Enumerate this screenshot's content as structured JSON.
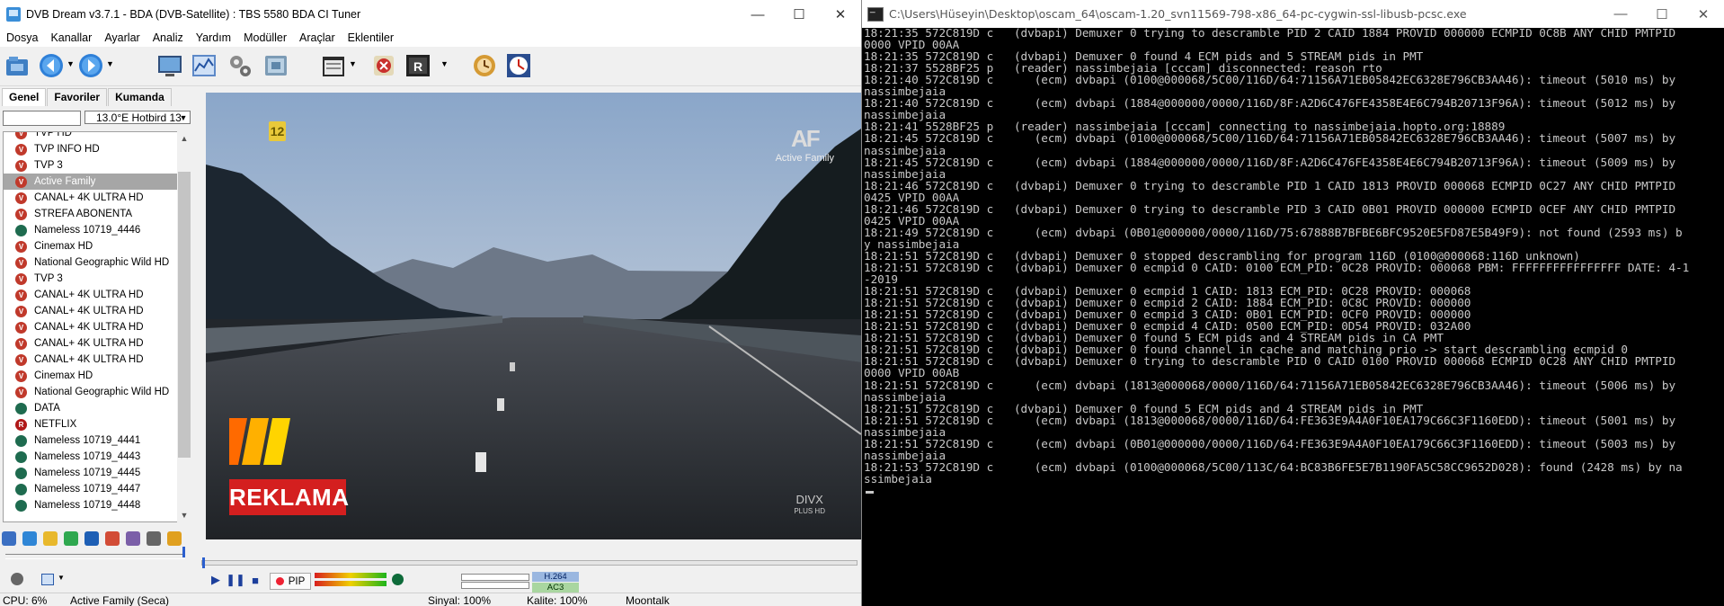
{
  "left_window": {
    "title": "DVB Dream v3.7.1 - BDA (DVB-Satellite)  :  TBS 5580 BDA CI Tuner",
    "menu": [
      "Dosya",
      "Kanallar",
      "Ayarlar",
      "Analiz",
      "Yardım",
      "Modüller",
      "Araçlar",
      "Eklentiler"
    ],
    "tabs": [
      "Genel",
      "Favoriler",
      "Kumanda"
    ],
    "satellite": "13.0°E Hotbird 13",
    "channels": [
      {
        "name": "TVP HD",
        "icon": "v"
      },
      {
        "name": "TVP INFO HD",
        "icon": "v"
      },
      {
        "name": "TVP 3",
        "icon": "v"
      },
      {
        "name": "Active Family",
        "icon": "v",
        "selected": true
      },
      {
        "name": "CANAL+ 4K ULTRA HD",
        "icon": "v"
      },
      {
        "name": "STREFA ABONENTA",
        "icon": "v"
      },
      {
        "name": "Nameless 10719_4446",
        "icon": "globe"
      },
      {
        "name": "Cinemax HD",
        "icon": "v"
      },
      {
        "name": "National Geographic Wild HD",
        "icon": "v"
      },
      {
        "name": "TVP 3",
        "icon": "v"
      },
      {
        "name": "CANAL+ 4K ULTRA HD",
        "icon": "v"
      },
      {
        "name": "CANAL+ 4K ULTRA HD",
        "icon": "v"
      },
      {
        "name": "CANAL+ 4K ULTRA HD",
        "icon": "v"
      },
      {
        "name": "CANAL+ 4K ULTRA HD",
        "icon": "v"
      },
      {
        "name": "CANAL+ 4K ULTRA HD",
        "icon": "v"
      },
      {
        "name": "Cinemax HD",
        "icon": "v"
      },
      {
        "name": "National Geographic Wild HD",
        "icon": "v"
      },
      {
        "name": "DATA",
        "icon": "globe"
      },
      {
        "name": "NETFLIX",
        "icon": "r"
      },
      {
        "name": "Nameless 10719_4441",
        "icon": "globe"
      },
      {
        "name": "Nameless 10719_4443",
        "icon": "globe"
      },
      {
        "name": "Nameless 10719_4445",
        "icon": "globe"
      },
      {
        "name": "Nameless 10719_4447",
        "icon": "globe"
      },
      {
        "name": "Nameless 10719_4448",
        "icon": "globe"
      }
    ],
    "video": {
      "channel_number": "12",
      "logo_line": "Active Family",
      "logo_mark": "AF",
      "banner": "REKLAMA",
      "divx": "DIVX",
      "divx_sub": "PLUS HD"
    },
    "controls": {
      "pip_label": "PIP",
      "video_codec": "H.264",
      "audio_codec": "AC3"
    },
    "status": {
      "cpu": "CPU: 6%",
      "channel": "Active Family (Seca)",
      "signal": "Sinyal: 100%",
      "quality": "Kalite: 100%",
      "weather": "Moontalk"
    }
  },
  "right_window": {
    "title": "C:\\Users\\Hüseyin\\Desktop\\oscam_64\\oscam-1.20_svn11569-798-x86_64-pc-cygwin-ssl-libusb-pcsc.exe",
    "lines": [
      "18:21:35 572C819D c   (dvbapi) Demuxer 0 trying to descramble PID 2 CAID 1884 PROVID 000000 ECMPID 0C8B ANY CHID PMTPID",
      "0000 VPID 00AA",
      "18:21:35 572C819D c   (dvbapi) Demuxer 0 found 4 ECM pids and 5 STREAM pids in PMT",
      "18:21:37 5528BF25 p   (reader) nassimbejaia [cccam] disconnected: reason rto",
      "18:21:40 572C819D c      (ecm) dvbapi (0100@000068/5C00/116D/64:71156A71EB05842EC6328E796CB3AA46): timeout (5010 ms) by",
      "nassimbejaia",
      "18:21:40 572C819D c      (ecm) dvbapi (1884@000000/0000/116D/8F:A2D6C476FE4358E4E6C794B20713F96A): timeout (5012 ms) by",
      "nassimbejaia",
      "18:21:41 5528BF25 p   (reader) nassimbejaia [cccam] connecting to nassimbejaia.hopto.org:18889",
      "18:21:45 572C819D c      (ecm) dvbapi (0100@000068/5C00/116D/64:71156A71EB05842EC6328E796CB3AA46): timeout (5007 ms) by",
      "nassimbejaia",
      "18:21:45 572C819D c      (ecm) dvbapi (1884@000000/0000/116D/8F:A2D6C476FE4358E4E6C794B20713F96A): timeout (5009 ms) by",
      "nassimbejaia",
      "18:21:46 572C819D c   (dvbapi) Demuxer 0 trying to descramble PID 1 CAID 1813 PROVID 000068 ECMPID 0C27 ANY CHID PMTPID",
      "0425 VPID 00AA",
      "18:21:46 572C819D c   (dvbapi) Demuxer 0 trying to descramble PID 3 CAID 0B01 PROVID 000000 ECMPID 0CEF ANY CHID PMTPID",
      "0425 VPID 00AA",
      "18:21:49 572C819D c      (ecm) dvbapi (0B01@000000/0000/116D/75:67888B7BFBE6BFC9520E5FD87E5B49F9): not found (2593 ms) b",
      "y nassimbejaia",
      "18:21:51 572C819D c   (dvbapi) Demuxer 0 stopped descrambling for program 116D (0100@000068:116D unknown)",
      "18:21:51 572C819D c   (dvbapi) Demuxer 0 ecmpid 0 CAID: 0100 ECM_PID: 0C28 PROVID: 000068 PBM: FFFFFFFFFFFFFFFF DATE: 4-1",
      "-2019",
      "18:21:51 572C819D c   (dvbapi) Demuxer 0 ecmpid 1 CAID: 1813 ECM_PID: 0C28 PROVID: 000068",
      "18:21:51 572C819D c   (dvbapi) Demuxer 0 ecmpid 2 CAID: 1884 ECM_PID: 0C8C PROVID: 000000",
      "18:21:51 572C819D c   (dvbapi) Demuxer 0 ecmpid 3 CAID: 0B01 ECM_PID: 0CF0 PROVID: 000000",
      "18:21:51 572C819D c   (dvbapi) Demuxer 0 ecmpid 4 CAID: 0500 ECM_PID: 0D54 PROVID: 032A00",
      "18:21:51 572C819D c   (dvbapi) Demuxer 0 found 5 ECM pids and 4 STREAM pids in CA PMT",
      "18:21:51 572C819D c   (dvbapi) Demuxer 0 found channel in cache and matching prio -> start descrambling ecmpid 0",
      "18:21:51 572C819D c   (dvbapi) Demuxer 0 trying to descramble PID 0 CAID 0100 PROVID 000068 ECMPID 0C28 ANY CHID PMTPID",
      "0000 VPID 00AB",
      "18:21:51 572C819D c      (ecm) dvbapi (1813@000068/0000/116D/64:71156A71EB05842EC6328E796CB3AA46): timeout (5006 ms) by",
      "nassimbejaia",
      "18:21:51 572C819D c   (dvbapi) Demuxer 0 found 5 ECM pids and 4 STREAM pids in PMT",
      "18:21:51 572C819D c      (ecm) dvbapi (1813@000068/0000/116D/64:FE363E9A4A0F10EA179C66C3F1160EDD): timeout (5001 ms) by",
      "nassimbejaia",
      "18:21:51 572C819D c      (ecm) dvbapi (0B01@000000/0000/116D/64:FE363E9A4A0F10EA179C66C3F1160EDD): timeout (5003 ms) by",
      "nassimbejaia",
      "18:21:53 572C819D c      (ecm) dvbapi (0100@000068/5C00/113C/64:BC83B6FE5E7B1190FA5C58CC9652D028): found (2428 ms) by na",
      "ssimbejaia"
    ]
  }
}
